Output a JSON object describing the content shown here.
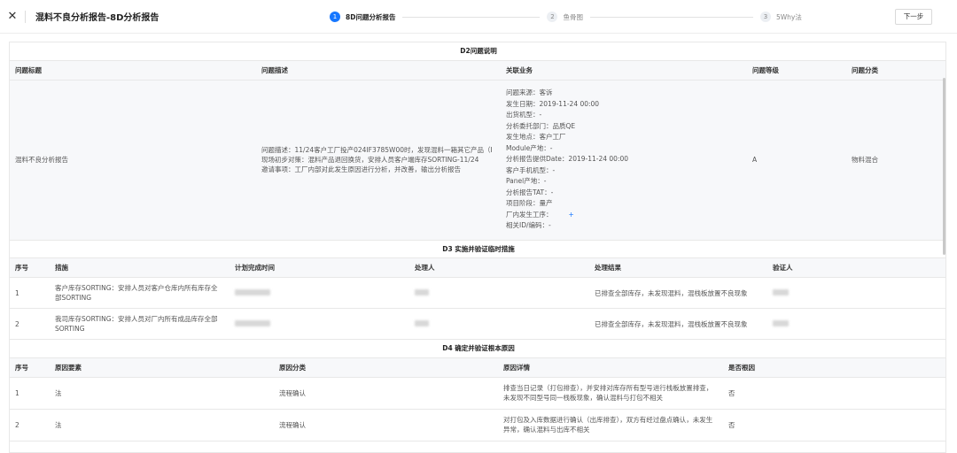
{
  "header": {
    "title": "混料不良分析报告-8D分析报告",
    "steps": [
      {
        "num": "1",
        "label": "8D问题分析报告",
        "active": true
      },
      {
        "num": "2",
        "label": "鱼骨图",
        "active": false
      },
      {
        "num": "3",
        "label": "5Why法",
        "active": false
      }
    ],
    "next_label": "下一步"
  },
  "d2": {
    "section_title": "D2问题说明",
    "columns": [
      "问题标题",
      "问题描述",
      "关联业务",
      "问题等级",
      "问题分类"
    ],
    "title_value": "混料不良分析报告",
    "desc_lines": [
      "问题描述：11/24客户工厂投产024IF3785W00时，发现混料一箱其它产品（I",
      "现场初步对策：混料产品退回换货，安排人员客户端库存SORTING-11/24",
      "邀请事项：工厂内部对此发生原因进行分析，并改善，输出分析报告"
    ],
    "related": [
      "问题来源：客诉",
      "发生日期：2019-11-24 00:00",
      "出货机型：-",
      "分析委托部门：品质QE",
      "发生地点：客户工厂",
      "Module产地：-",
      "分析报告提供Date：2019-11-24 00:00",
      "客户手机机型：-",
      "Panel产地：-",
      "分析报告TAT：-",
      "项目阶段：量产",
      "厂内发生工序：",
      "相关ID/编码：-"
    ],
    "plus_glyph": "+",
    "level": "A",
    "category": "物料混合"
  },
  "d3": {
    "section_title": "D3 实施并验证临时措施",
    "columns": [
      "序号",
      "措施",
      "计划完成时间",
      "处理人",
      "处理结果",
      "验证人"
    ],
    "rows": [
      {
        "no": "1",
        "measure": "客户库存SORTING：安排人员对客户仓库内所有库存全部SORTING",
        "result": "已排查全部库存，未发现混料，混栈板放置不良现象"
      },
      {
        "no": "2",
        "measure": "我司库存SORTING：安排人员对厂内所有成品库存全部SORTING",
        "result": "已排查全部库存，未发现混料，混栈板放置不良现象"
      }
    ]
  },
  "d4": {
    "section_title": "D4 确定并验证根本原因",
    "columns": [
      "序号",
      "原因要素",
      "原因分类",
      "原因详情",
      "是否根因"
    ],
    "rows": [
      {
        "no": "1",
        "factor": "法",
        "category": "流程确认",
        "detail": "排查当日记录（打包排查），并安排对库存所有型号进行栈板放置排查，未发现不同型号同一栈板现象，确认混料与打包不相关",
        "root": "否"
      },
      {
        "no": "2",
        "factor": "法",
        "category": "流程确认",
        "detail": "对打包及入库数据进行确认（出库排查），双方有经过盘点确认，未发生异常，确认混料与出库不相关",
        "root": "否"
      }
    ]
  }
}
